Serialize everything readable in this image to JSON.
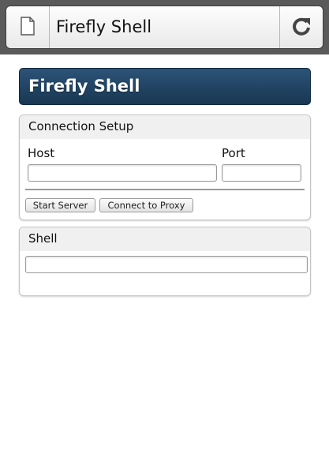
{
  "browser": {
    "tab_title": "Firefly Shell",
    "page_icon": "page-icon",
    "reload_icon": "reload-icon"
  },
  "header": {
    "title": "Firefly Shell"
  },
  "connection": {
    "title": "Connection Setup",
    "host_label": "Host",
    "host_value": "",
    "port_label": "Port",
    "port_value": "",
    "start_server_label": "Start Server",
    "connect_proxy_label": "Connect to Proxy"
  },
  "shell": {
    "title": "Shell",
    "input_value": ""
  },
  "colors": {
    "banner_top": "#2c5378",
    "banner_bottom": "#183752",
    "chrome": "#5a5a5a"
  }
}
